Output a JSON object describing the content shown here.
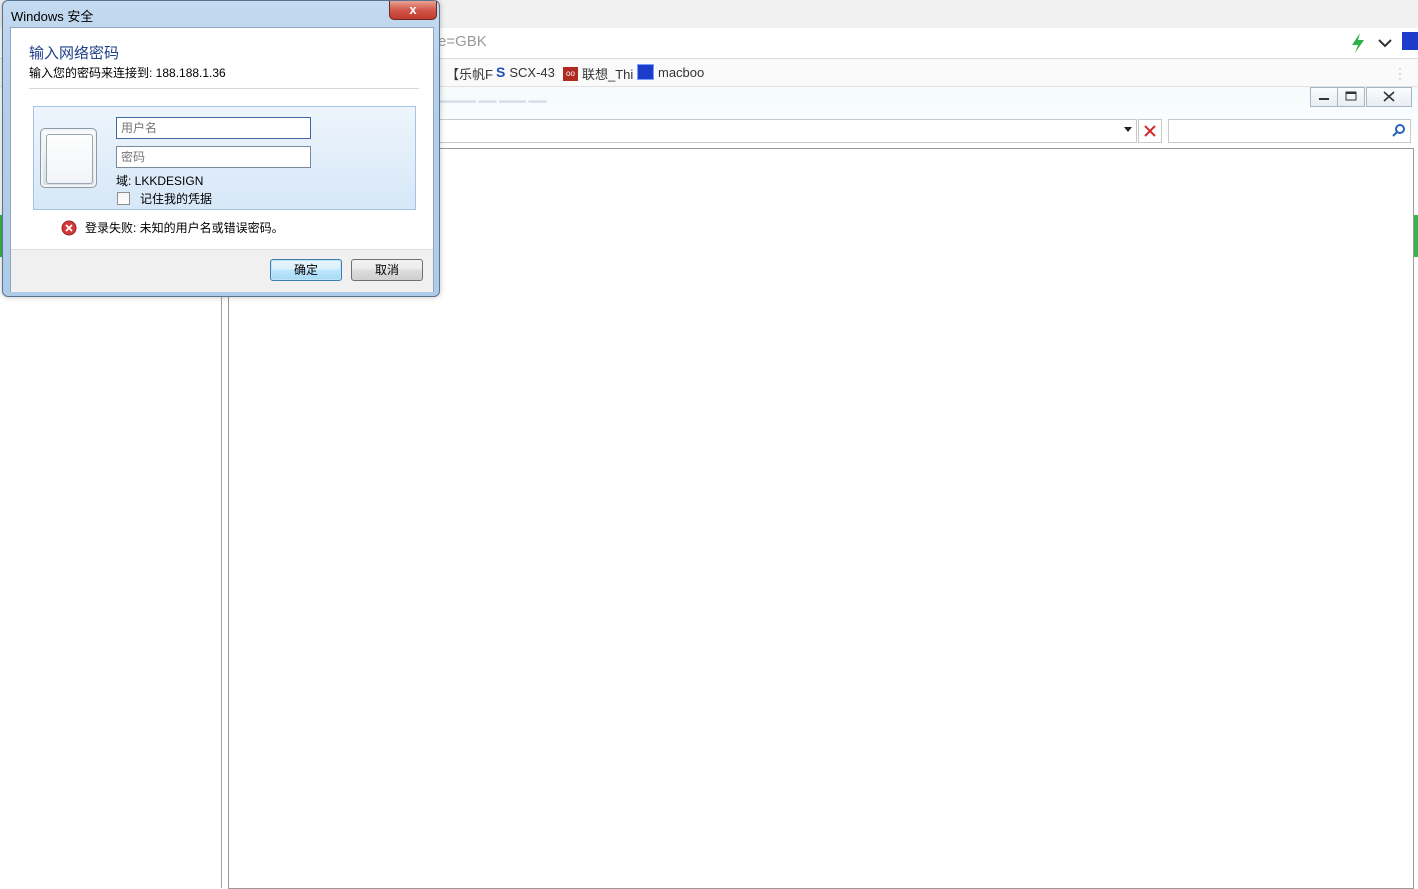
{
  "browser": {
    "address_text": "e=GBK",
    "bookmarks": [
      {
        "label": "【乐帆F",
        "icon": "bracket-icon"
      },
      {
        "label": "SCX-43",
        "icon": "s-logo-icon"
      },
      {
        "label": "联想_Thi",
        "icon": "lenovo-icon"
      },
      {
        "label": "macboo",
        "icon": "paw-icon"
      }
    ]
  },
  "dialog": {
    "title": "Windows 安全",
    "close_label": "x",
    "heading": "输入网络密码",
    "subtitle": "输入您的密码来连接到: 188.188.1.36",
    "username_placeholder": "用户名",
    "password_placeholder": "密码",
    "domain_text": "域: LKKDESIGN",
    "remember_label": "记住我的凭据",
    "remember_checked": false,
    "error_text": "登录失败: 未知的用户名或错误密码。",
    "ok_label": "确定",
    "cancel_label": "取消"
  },
  "colors": {
    "heading": "#1e3f8a",
    "close_button": "#c8473a",
    "error_icon": "#d23a3a",
    "accent_green": "#3bb34a"
  }
}
